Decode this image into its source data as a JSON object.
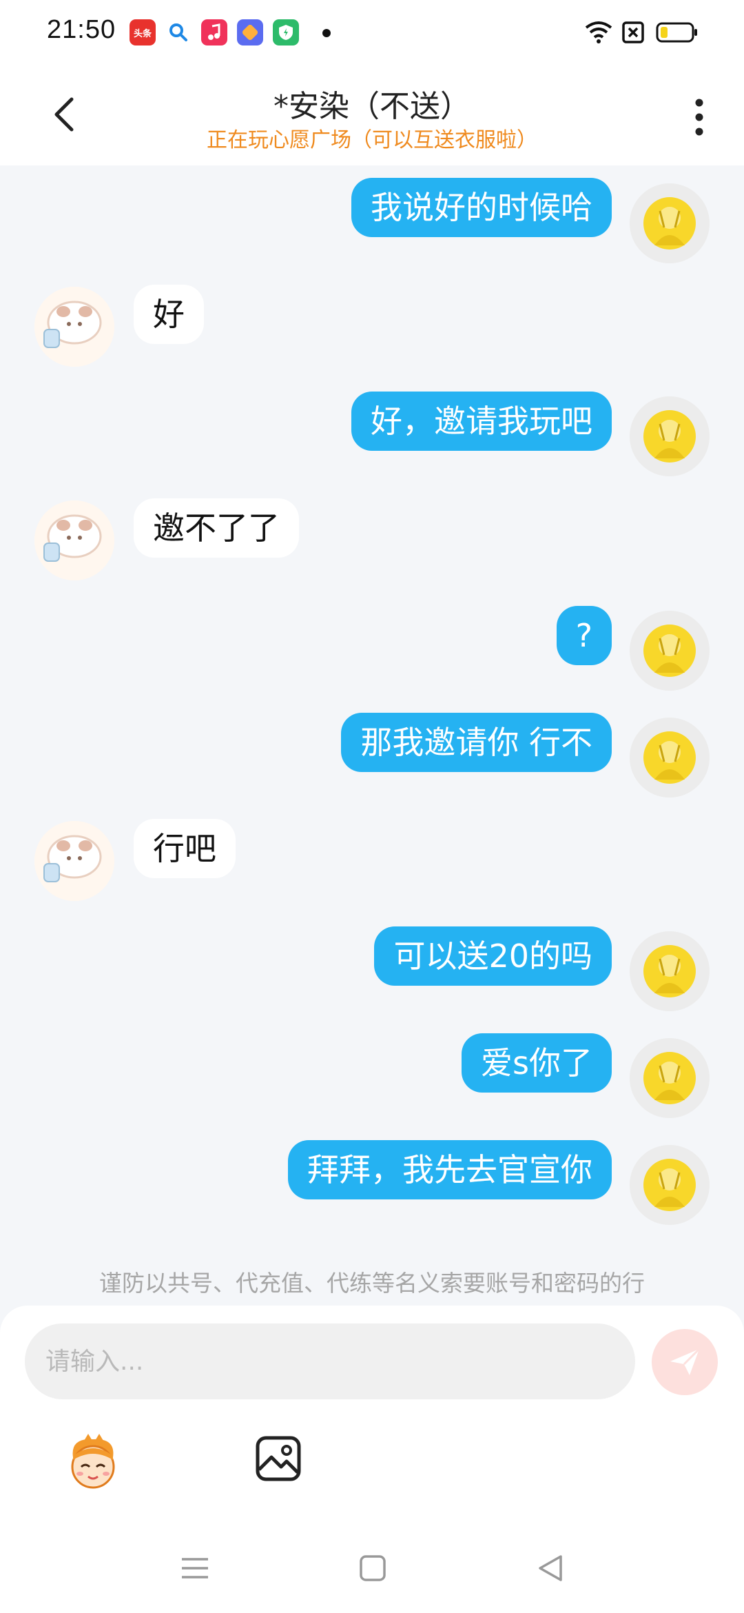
{
  "status_bar": {
    "time": "21:50",
    "app_icons": [
      {
        "name": "toutiao-app-icon",
        "label": "头条",
        "color": "#e8322d"
      },
      {
        "name": "search-app-icon",
        "label": "",
        "color": "#ffffff"
      },
      {
        "name": "music-app-icon",
        "label": "",
        "color": "#f0325a"
      },
      {
        "name": "app-store-icon",
        "label": "",
        "color": "#5b6cf0"
      },
      {
        "name": "security-app-icon",
        "label": "",
        "color": "#2dbb6a"
      }
    ]
  },
  "header": {
    "title": "*安染（不送）",
    "subtitle": "正在玩心愿广场（可以互送衣服啦）"
  },
  "messages": [
    {
      "side": "me",
      "text": "我说好的时候哈"
    },
    {
      "side": "other",
      "text": "好"
    },
    {
      "side": "me",
      "text": "好，邀请我玩吧"
    },
    {
      "side": "other",
      "text": "邀不了了"
    },
    {
      "side": "me",
      "text": "?"
    },
    {
      "side": "me",
      "text": "那我邀请你 行不"
    },
    {
      "side": "other",
      "text": "行吧"
    },
    {
      "side": "me",
      "text": "可以送20的吗"
    },
    {
      "side": "me",
      "text": "爱s你了"
    },
    {
      "side": "me",
      "text": "拜拜，我先去官宣你"
    }
  ],
  "notice": "谨防以共号、代充值、代练等名义索要账号和密码的行",
  "input": {
    "placeholder": "请输入..."
  },
  "colors": {
    "my_bubble": "#25b2f2",
    "other_bubble": "#ffffff",
    "subtitle": "#ef8a1e",
    "send_button": "#fde0dd",
    "background": "#f4f6f9"
  },
  "icons": {
    "back": "chevron-left-icon",
    "more": "more-vertical-icon",
    "send": "send-icon",
    "emoji": "emoji-character-icon",
    "image": "image-icon",
    "wifi": "wifi-icon",
    "sim": "sim-icon",
    "battery": "battery-icon",
    "nav_menu": "menu-icon",
    "nav_home": "home-icon",
    "nav_back": "back-triangle-icon"
  }
}
